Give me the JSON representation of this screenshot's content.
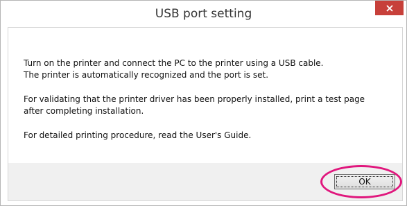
{
  "window": {
    "title": "USB port setting",
    "close_icon": "close-icon"
  },
  "message": {
    "line1": "Turn on the printer and connect the PC to the printer using a USB cable.",
    "line2": "The printer is automatically recognized and the port is set.",
    "line3": "For validating that the printer driver has been properly installed, print a test page",
    "line4": "after completing installation.",
    "line5": "For detailed printing procedure, read the User's Guide."
  },
  "buttons": {
    "ok_label": "OK"
  },
  "colors": {
    "close_button": "#c7403a",
    "highlight": "#e0177d"
  }
}
